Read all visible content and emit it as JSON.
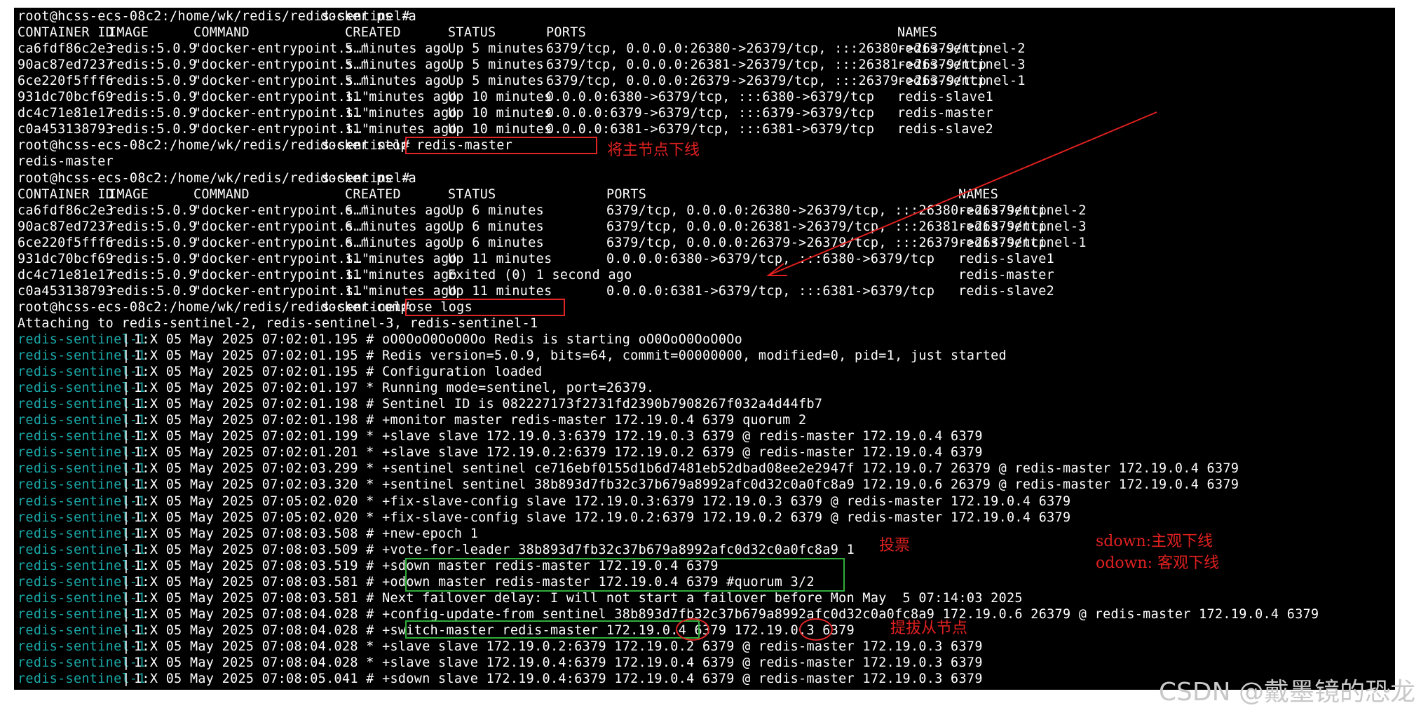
{
  "prompt": "root@hcss-ecs-08c2:/home/wk/redis/redis-sentinel# ",
  "commands": {
    "ps1": "docker ps -a",
    "stop": "docker stop redis-master",
    "ps2": "docker ps -a",
    "compose": "docker-compose logs"
  },
  "stop_output": "redis-master",
  "headers": {
    "container_id": "CONTAINER ID",
    "image": "IMAGE",
    "command": "COMMAND",
    "created": "CREATED",
    "status": "STATUS",
    "ports": "PORTS",
    "names": "NAMES"
  },
  "table1": [
    {
      "id": "ca6fdf86c2e3",
      "image": "redis:5.0.9",
      "command": "\"docker-entrypoint.s…\"",
      "created": "5 minutes ago",
      "status": "Up 5 minutes",
      "ports": "6379/tcp, 0.0.0.0:26380->26379/tcp, :::26380->26379/tcp",
      "names": "redis-sentinel-2"
    },
    {
      "id": "90ac87ed7237",
      "image": "redis:5.0.9",
      "command": "\"docker-entrypoint.s…\"",
      "created": "5 minutes ago",
      "status": "Up 5 minutes",
      "ports": "6379/tcp, 0.0.0.0:26381->26379/tcp, :::26381->26379/tcp",
      "names": "redis-sentinel-3"
    },
    {
      "id": "6ce220f5fff6",
      "image": "redis:5.0.9",
      "command": "\"docker-entrypoint.s…\"",
      "created": "5 minutes ago",
      "status": "Up 5 minutes",
      "ports": "6379/tcp, 0.0.0.0:26379->26379/tcp, :::26379->26379/tcp",
      "names": "redis-sentinel-1"
    },
    {
      "id": "931dc70bcf69",
      "image": "redis:5.0.9",
      "command": "\"docker-entrypoint.s…\"",
      "created": "11 minutes ago",
      "status": "Up 10 minutes",
      "ports": "0.0.0.0:6380->6379/tcp, :::6380->6379/tcp",
      "names": "redis-slave1"
    },
    {
      "id": "dc4c71e81e17",
      "image": "redis:5.0.9",
      "command": "\"docker-entrypoint.s…\"",
      "created": "11 minutes ago",
      "status": "Up 10 minutes",
      "ports": "0.0.0.0:6379->6379/tcp, :::6379->6379/tcp",
      "names": "redis-master"
    },
    {
      "id": "c0a453138793",
      "image": "redis:5.0.9",
      "command": "\"docker-entrypoint.s…\"",
      "created": "11 minutes ago",
      "status": "Up 10 minutes",
      "ports": "0.0.0.0:6381->6379/tcp, :::6381->6379/tcp",
      "names": "redis-slave2"
    }
  ],
  "table2": [
    {
      "id": "ca6fdf86c2e3",
      "image": "redis:5.0.9",
      "command": "\"docker-entrypoint.s…\"",
      "created": "6 minutes ago",
      "status": "Up 6 minutes",
      "ports": "6379/tcp, 0.0.0.0:26380->26379/tcp, :::26380->26379/tcp",
      "names": "redis-sentinel-2"
    },
    {
      "id": "90ac87ed7237",
      "image": "redis:5.0.9",
      "command": "\"docker-entrypoint.s…\"",
      "created": "6 minutes ago",
      "status": "Up 6 minutes",
      "ports": "6379/tcp, 0.0.0.0:26381->26379/tcp, :::26381->26379/tcp",
      "names": "redis-sentinel-3"
    },
    {
      "id": "6ce220f5fff6",
      "image": "redis:5.0.9",
      "command": "\"docker-entrypoint.s…\"",
      "created": "6 minutes ago",
      "status": "Up 6 minutes",
      "ports": "6379/tcp, 0.0.0.0:26379->26379/tcp, :::26379->26379/tcp",
      "names": "redis-sentinel-1"
    },
    {
      "id": "931dc70bcf69",
      "image": "redis:5.0.9",
      "command": "\"docker-entrypoint.s…\"",
      "created": "11 minutes ago",
      "status": "Up 11 minutes",
      "ports": "0.0.0.0:6380->6379/tcp, :::6380->6379/tcp",
      "names": "redis-slave1"
    },
    {
      "id": "dc4c71e81e17",
      "image": "redis:5.0.9",
      "command": "\"docker-entrypoint.s…\"",
      "created": "11 minutes ago",
      "status": "Exited (0) 1 second ago",
      "ports": "",
      "names": "redis-master"
    },
    {
      "id": "c0a453138793",
      "image": "redis:5.0.9",
      "command": "\"docker-entrypoint.s…\"",
      "created": "11 minutes ago",
      "status": "Up 11 minutes",
      "ports": "0.0.0.0:6381->6379/tcp, :::6381->6379/tcp",
      "names": "redis-slave2"
    }
  ],
  "attaching": "Attaching to redis-sentinel-2, redis-sentinel-3, redis-sentinel-1",
  "log_tag": "redis-sentinel-1",
  "log_sep": " | ",
  "logs": [
    "1:X 05 May 2025 07:02:01.195 # oO0OoO0OoO0Oo Redis is starting oO0OoO0OoO0Oo",
    "1:X 05 May 2025 07:02:01.195 # Redis version=5.0.9, bits=64, commit=00000000, modified=0, pid=1, just started",
    "1:X 05 May 2025 07:02:01.195 # Configuration loaded",
    "1:X 05 May 2025 07:02:01.197 * Running mode=sentinel, port=26379.",
    "1:X 05 May 2025 07:02:01.198 # Sentinel ID is 082227173f2731fd2390b7908267f032a4d44fb7",
    "1:X 05 May 2025 07:02:01.198 # +monitor master redis-master 172.19.0.4 6379 quorum 2",
    "1:X 05 May 2025 07:02:01.199 * +slave slave 172.19.0.3:6379 172.19.0.3 6379 @ redis-master 172.19.0.4 6379",
    "1:X 05 May 2025 07:02:01.201 * +slave slave 172.19.0.2:6379 172.19.0.2 6379 @ redis-master 172.19.0.4 6379",
    "1:X 05 May 2025 07:02:03.299 * +sentinel sentinel ce716ebf0155d1b6d7481eb52dbad08ee2e2947f 172.19.0.7 26379 @ redis-master 172.19.0.4 6379",
    "1:X 05 May 2025 07:02:03.320 * +sentinel sentinel 38b893d7fb32c37b679a8992afc0d32c0a0fc8a9 172.19.0.6 26379 @ redis-master 172.19.0.4 6379",
    "1:X 05 May 2025 07:05:02.020 * +fix-slave-config slave 172.19.0.3:6379 172.19.0.3 6379 @ redis-master 172.19.0.4 6379",
    "1:X 05 May 2025 07:05:02.020 * +fix-slave-config slave 172.19.0.2:6379 172.19.0.2 6379 @ redis-master 172.19.0.4 6379",
    "1:X 05 May 2025 07:08:03.508 # +new-epoch 1",
    "1:X 05 May 2025 07:08:03.509 # +vote-for-leader 38b893d7fb32c37b679a8992afc0d32c0a0fc8a9 1",
    "1:X 05 May 2025 07:08:03.519 # +sdown master redis-master 172.19.0.4 6379",
    "1:X 05 May 2025 07:08:03.581 # +odown master redis-master 172.19.0.4 6379 #quorum 3/2",
    "1:X 05 May 2025 07:08:03.581 # Next failover delay: I will not start a failover before Mon May  5 07:14:03 2025",
    "1:X 05 May 2025 07:08:04.028 # +config-update-from sentinel 38b893d7fb32c37b679a8992afc0d32c0a0fc8a9 172.19.0.6 26379 @ redis-master 172.19.0.4 6379",
    "1:X 05 May 2025 07:08:04.028 # +switch-master redis-master 172.19.0.4 6379 172.19.0.3 6379",
    "1:X 05 May 2025 07:08:04.028 * +slave slave 172.19.0.2:6379 172.19.0.2 6379 @ redis-master 172.19.0.3 6379",
    "1:X 05 May 2025 07:08:04.028 * +slave slave 172.19.0.4:6379 172.19.0.4 6379 @ redis-master 172.19.0.3 6379",
    "1:X 05 May 2025 07:08:05.041 # +sdown slave 172.19.0.4:6379 172.19.0.4 6379 @ redis-master 172.19.0.3 6379"
  ],
  "annotations": {
    "stop_master": "将主节点下线",
    "vote": "投票",
    "sdown": "sdown:主观下线",
    "odown": "odown: 客观下线",
    "promote": "提拔从节点"
  },
  "colors": {
    "terminal_bg": "#000000",
    "terminal_text": "#ffffff",
    "log_tag": "#1aa8a8",
    "annotation_red": "#e02020",
    "highlight_green": "#2fae3a"
  },
  "watermark": "CSDN @戴墨镜的恐龙"
}
